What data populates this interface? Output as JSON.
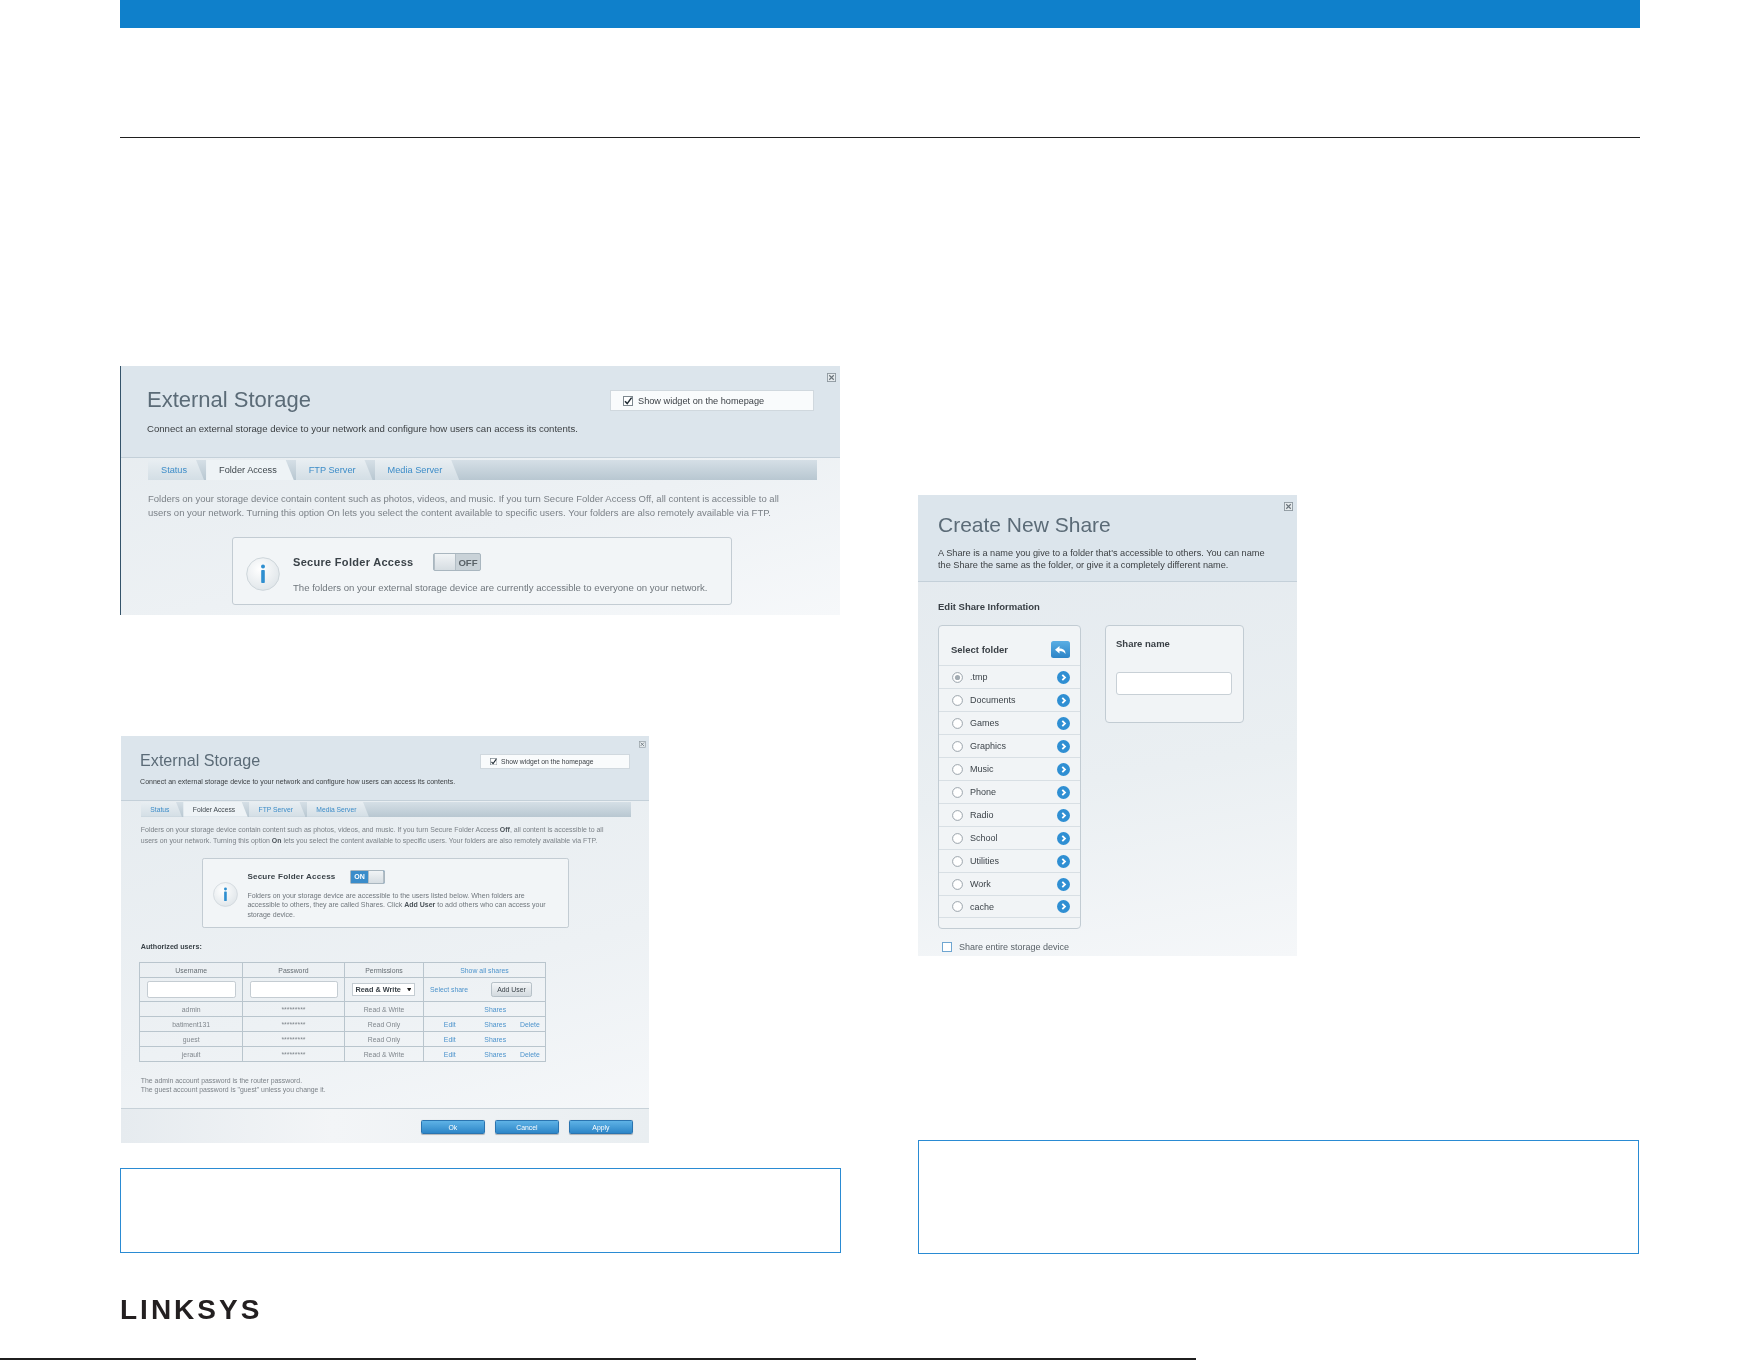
{
  "external_storage_panels": [
    {
      "title": "External Storage",
      "show_widget": {
        "label": "Show widget on the homepage",
        "checked": true
      },
      "subtitle": "Connect an external storage device to your network and configure how users can access its contents.",
      "tabs": [
        {
          "label": "Status",
          "selected": false
        },
        {
          "label": "Folder Access",
          "selected": true
        },
        {
          "label": "FTP Server",
          "selected": false
        },
        {
          "label": "Media Server",
          "selected": false
        }
      ],
      "description": "Folders on your storage device contain content such as photos, videos, and music. If you turn Secure Folder Access Off, all content is accessible to all users on your network. Turning this option On lets you select the content available to specific users. Your folders are also remotely available via FTP.",
      "secure_access": {
        "title": "Secure Folder Access",
        "on": false,
        "toggle_label": "OFF",
        "message": "The folders on your external storage device are currently accessible to everyone on your network."
      }
    },
    {
      "title": "External Storage",
      "show_widget": {
        "label": "Show widget on the homepage",
        "checked": true
      },
      "subtitle": "Connect an external storage device to your network and configure how users can access its contents.",
      "tabs": [
        {
          "label": "Status",
          "selected": false
        },
        {
          "label": "Folder Access",
          "selected": true
        },
        {
          "label": "FTP Server",
          "selected": false
        },
        {
          "label": "Media Server",
          "selected": false
        }
      ],
      "description": "Folders on your storage device contain content such as photos, videos, and music. If you turn Secure Folder Access **Off**, all content is accessible to all users on your network. Turning this option **On** lets you select the content available to specific users. Your folders are also remotely available via FTP.",
      "secure_access": {
        "title": "Secure Folder Access",
        "on": true,
        "toggle_label": "ON",
        "message": "Folders on your storage device are accessible to the users listed below. When folders are accessible to others, they are called Shares. Click **Add User** to add others who can access your storage device."
      },
      "authorized_users": {
        "heading": "Authorized users:",
        "columns": [
          "Username",
          "Password",
          "Permissions"
        ],
        "show_all_link": "Show all shares",
        "new_user": {
          "permission": "Read & Write",
          "select_share_link": "Select share",
          "add_button": "Add User"
        },
        "rows": [
          {
            "username": "admin",
            "password": "*********",
            "permission": "Read & Write",
            "actions": [
              {
                "kind": "shares",
                "label": "Shares"
              }
            ]
          },
          {
            "username": "batiment131",
            "password": "*********",
            "permission": "Read Only",
            "actions": [
              {
                "kind": "edit",
                "label": "Edit"
              },
              {
                "kind": "shares",
                "label": "Shares"
              },
              {
                "kind": "delete",
                "label": "Delete"
              }
            ]
          },
          {
            "username": "guest",
            "password": "*********",
            "permission": "Read Only",
            "actions": [
              {
                "kind": "edit",
                "label": "Edit"
              },
              {
                "kind": "shares",
                "label": "Shares"
              }
            ]
          },
          {
            "username": "jerault",
            "password": "*********",
            "permission": "Read & Write",
            "actions": [
              {
                "kind": "edit",
                "label": "Edit"
              },
              {
                "kind": "shares",
                "label": "Shares"
              },
              {
                "kind": "delete",
                "label": "Delete"
              }
            ]
          }
        ]
      },
      "notes": [
        "The admin account password is the router password.",
        "The guest account password is \"guest\" unless you change it."
      ],
      "buttons": [
        {
          "label": "Ok"
        },
        {
          "label": "Cancel"
        },
        {
          "label": "Apply"
        }
      ]
    }
  ],
  "create_new_share": {
    "title": "Create New Share",
    "description": "A Share is a name you give to a folder that's accessible to others. You can name the Share the same as the folder, or give it a completely different name.",
    "section_heading": "Edit Share Information",
    "folder_list": {
      "heading": "Select folder",
      "folders": [
        {
          "name": ".tmp",
          "selected": true
        },
        {
          "name": "Documents",
          "selected": false
        },
        {
          "name": "Games",
          "selected": false
        },
        {
          "name": "Graphics",
          "selected": false
        },
        {
          "name": "Music",
          "selected": false
        },
        {
          "name": "Phone",
          "selected": false
        },
        {
          "name": "Radio",
          "selected": false
        },
        {
          "name": "School",
          "selected": false
        },
        {
          "name": "Utilities",
          "selected": false
        },
        {
          "name": "Work",
          "selected": false
        },
        {
          "name": "cache",
          "selected": false
        }
      ]
    },
    "share_name": {
      "label": "Share name"
    },
    "share_entire_device": {
      "label": "Share entire storage device",
      "checked": false
    }
  },
  "logo": "LINKSYS"
}
